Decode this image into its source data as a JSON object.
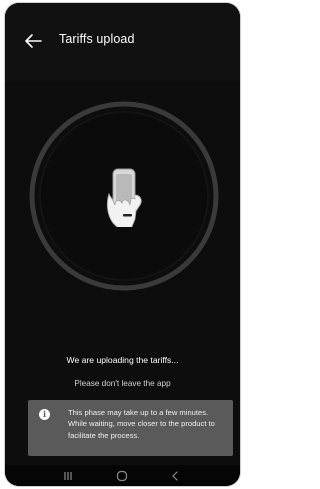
{
  "header": {
    "title": "Tariffs upload",
    "back_icon": "arrow-left-icon"
  },
  "illustration": {
    "icon": "hand-holding-phone-icon"
  },
  "status": {
    "message": "We are uploading the tariffs...",
    "submessage": "Please don't leave the app"
  },
  "notice": {
    "icon": "info-icon",
    "icon_glyph": "i",
    "text": "This phase may take up to a few minutes. While waiting, move closer to the product to facilitate the process."
  },
  "navigation_bar": {
    "buttons": [
      "recent-apps-icon",
      "home-icon",
      "back-icon"
    ]
  },
  "colors": {
    "background": "#0d0d0d",
    "ring": "#3a3a3a",
    "notice_background": "#5a5a5a",
    "text_primary": "#ffffff"
  }
}
